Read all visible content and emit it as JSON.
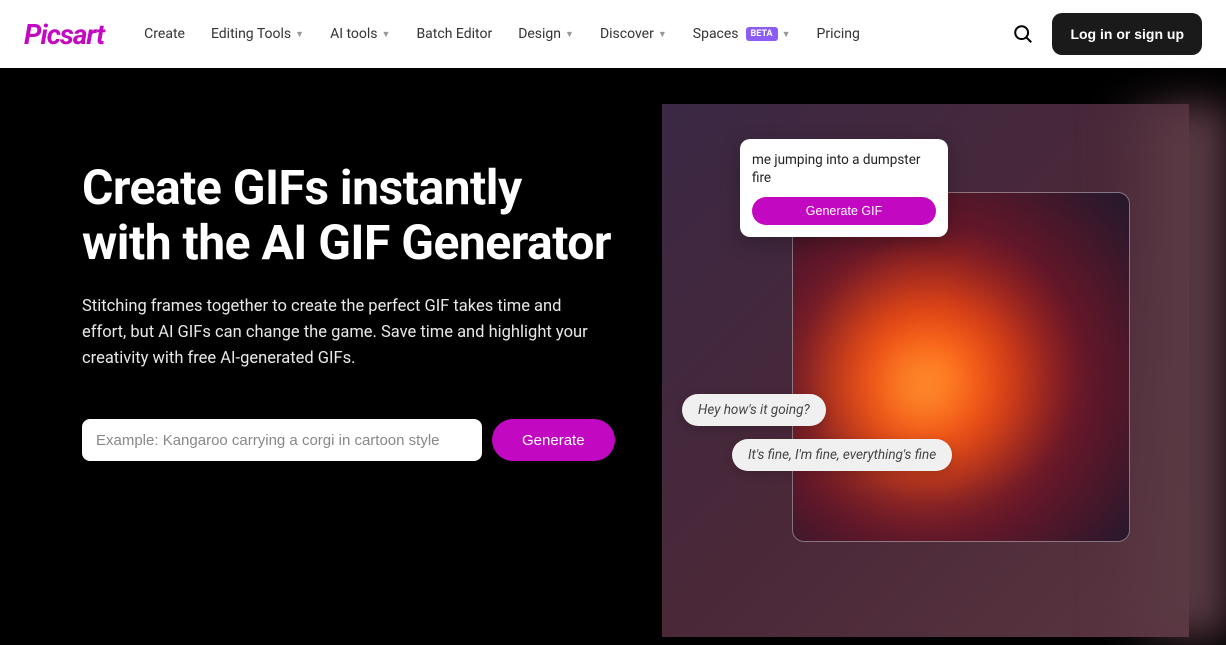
{
  "header": {
    "logo": "Picsart",
    "nav": [
      {
        "label": "Create",
        "dropdown": false
      },
      {
        "label": "Editing Tools",
        "dropdown": true
      },
      {
        "label": "AI tools",
        "dropdown": true
      },
      {
        "label": "Batch Editor",
        "dropdown": false
      },
      {
        "label": "Design",
        "dropdown": true
      },
      {
        "label": "Discover",
        "dropdown": true
      },
      {
        "label": "Spaces",
        "dropdown": true,
        "badge": "BETA"
      },
      {
        "label": "Pricing",
        "dropdown": false
      }
    ],
    "login": "Log in or sign up"
  },
  "hero": {
    "title": "Create GIFs instantly with the AI GIF Generator",
    "description": "Stitching frames together to create the perfect GIF takes time and effort, but AI GIFs can change the game. Save time and highlight your creativity with free AI-generated GIFs.",
    "input_placeholder": "Example: Kangaroo carrying a corgi in cartoon style",
    "generate_label": "Generate"
  },
  "preview": {
    "prompt_text": "me jumping into a dumpster fire",
    "prompt_button": "Generate GIF",
    "chat1": "Hey how's it going?",
    "chat2": "It's fine, I'm fine, everything's fine"
  },
  "colors": {
    "brand": "#c209c1",
    "dark": "#000000"
  }
}
